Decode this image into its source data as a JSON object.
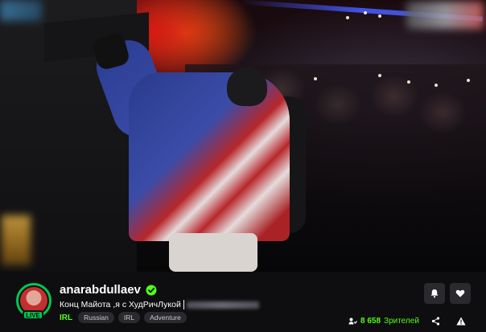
{
  "stream": {
    "live_label": "LIVE"
  },
  "channel": {
    "name": "anarabdullaev",
    "verified": true
  },
  "stream_info": {
    "title": "Конц Майота ,я с ХудРичЛукой",
    "category": "IRL",
    "tags": [
      "Russian",
      "IRL",
      "Adventure"
    ],
    "viewer_count": "8 658",
    "viewer_label": "Зрителей"
  },
  "colors": {
    "accent": "#53fc18",
    "live_ring": "#00c850",
    "background": "#0e0e10",
    "button_bg": "#2a2a2e"
  },
  "icons": {
    "bell": "bell-icon",
    "heart": "heart-icon",
    "share": "share-icon",
    "report": "warning-icon",
    "viewers": "viewers-icon",
    "verified": "verified-badge-icon"
  }
}
